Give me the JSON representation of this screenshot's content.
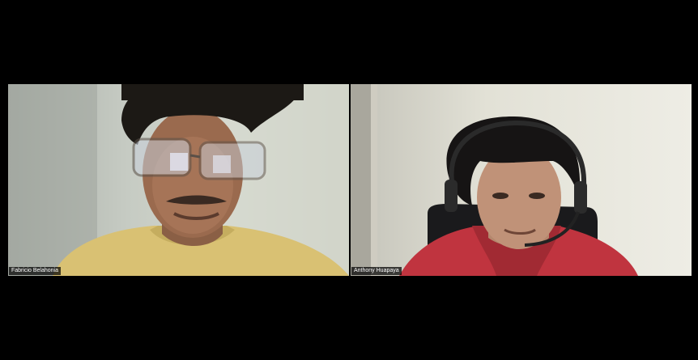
{
  "participants": [
    {
      "name": "Fabricio Belahonia"
    },
    {
      "name": "Anthony Huapaya"
    }
  ],
  "colors": {
    "background": "#000000",
    "label_bg": "#000000",
    "label_text": "#ffffff"
  }
}
